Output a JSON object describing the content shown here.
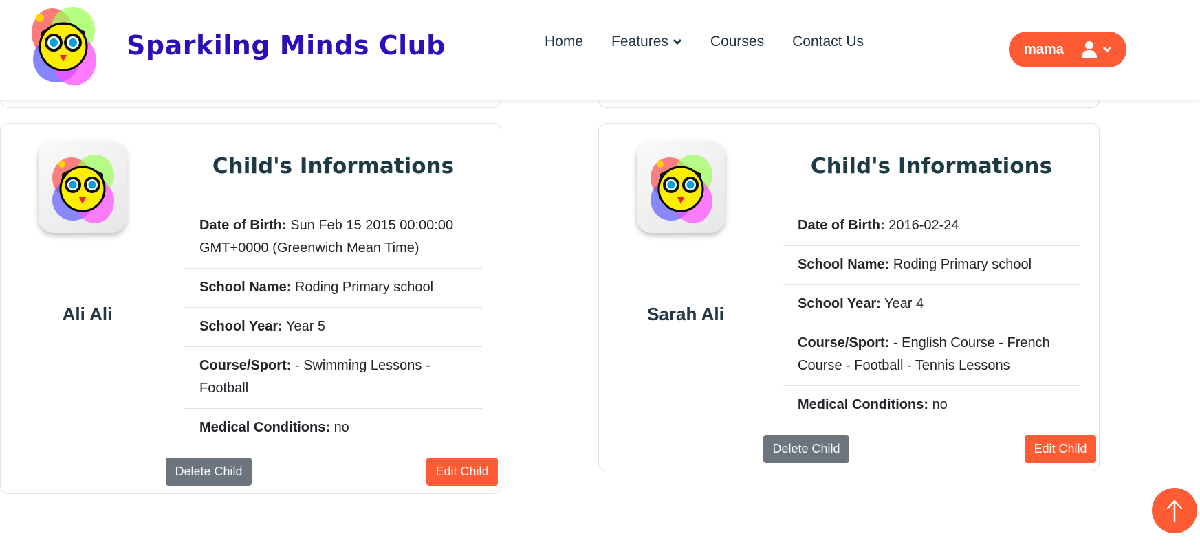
{
  "header": {
    "brand": "Sparkilng Minds Club",
    "nav": [
      {
        "label": "Home"
      },
      {
        "label": "Features"
      },
      {
        "label": "Courses"
      },
      {
        "label": "Contact Us"
      }
    ],
    "user": {
      "name": "mama"
    }
  },
  "colors": {
    "accent": "#ff5b35",
    "brand": "#2a10b8",
    "gray_button": "#6c757d"
  },
  "children": [
    {
      "name": "Ali Ali",
      "title": "Child's Informations",
      "dob_label": "Date of Birth:",
      "dob": "Sun Feb 15 2015 00:00:00 GMT+0000 (Greenwich Mean Time)",
      "school_label": "School Name:",
      "school": "Roding Primary school",
      "year_label": "School Year:",
      "year": "Year 5",
      "course_label": "Course/Sport:",
      "course": "- Swimming Lessons - Football",
      "medical_label": "Medical Conditions:",
      "medical": "no",
      "delete_label": "Delete Child",
      "edit_label": "Edit Child"
    },
    {
      "name": "Sarah Ali",
      "title": "Child's Informations",
      "dob_label": "Date of Birth:",
      "dob": "2016-02-24",
      "school_label": "School Name:",
      "school": "Roding Primary school",
      "year_label": "School Year:",
      "year": "Year 4",
      "course_label": "Course/Sport:",
      "course": "- English Course - French Course - Football - Tennis Lessons",
      "medical_label": "Medical Conditions:",
      "medical": "no",
      "delete_label": "Delete Child",
      "edit_label": "Edit Child"
    }
  ],
  "icons": [
    "logo-owl-icon",
    "chevron-down-icon",
    "user-icon",
    "arrow-up-icon"
  ]
}
